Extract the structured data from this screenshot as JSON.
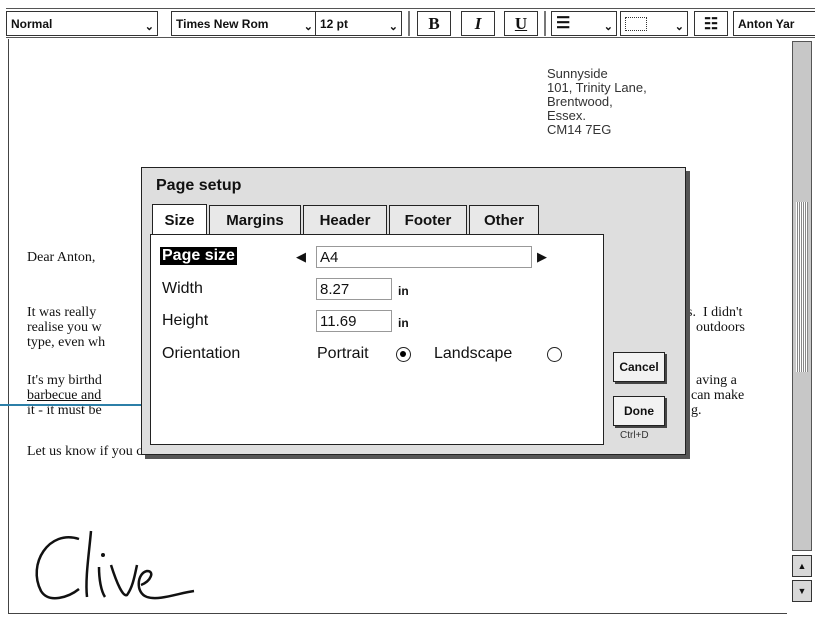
{
  "toolbar": {
    "style": "Normal",
    "font": "Times New Rom",
    "size": "12 pt",
    "bold": "B",
    "italic": "I",
    "underline": "U",
    "align_icon": "align-left-icon",
    "border_icon": "border-icon",
    "bullets_icon": "bullet-list-icon",
    "recipient": "Anton Yar"
  },
  "letter": {
    "address": [
      "Sunnyside",
      "101, Trinity Lane,",
      "Brentwood,",
      "Essex.",
      "CM14 7EG"
    ],
    "salutation": "Dear Anton,",
    "para1": [
      "It was really",
      "realise you w",
      "type, even wh"
    ],
    "para1_right": [
      "s.  I didn't",
      "outdoors"
    ],
    "para2": [
      "It's my birthd",
      "barbecue and",
      "it - it must be"
    ],
    "para2_right": [
      "aving a",
      "can make",
      "g."
    ],
    "para3": "Let us know if you can make it.",
    "signature": "Clive"
  },
  "dialog": {
    "title": "Page setup",
    "tabs": [
      "Size",
      "Margins",
      "Header",
      "Footer",
      "Other"
    ],
    "active_tab": "Size",
    "page_size_label": "Page size",
    "page_size_value": "A4",
    "width_label": "Width",
    "width_value": "8.27",
    "height_label": "Height",
    "height_value": "11.69",
    "unit": "in",
    "orientation_label": "Orientation",
    "portrait": "Portrait",
    "landscape": "Landscape",
    "orientation_selected": "Portrait",
    "cancel": "Cancel",
    "done": "Done",
    "done_shortcut": "Ctrl+D"
  }
}
